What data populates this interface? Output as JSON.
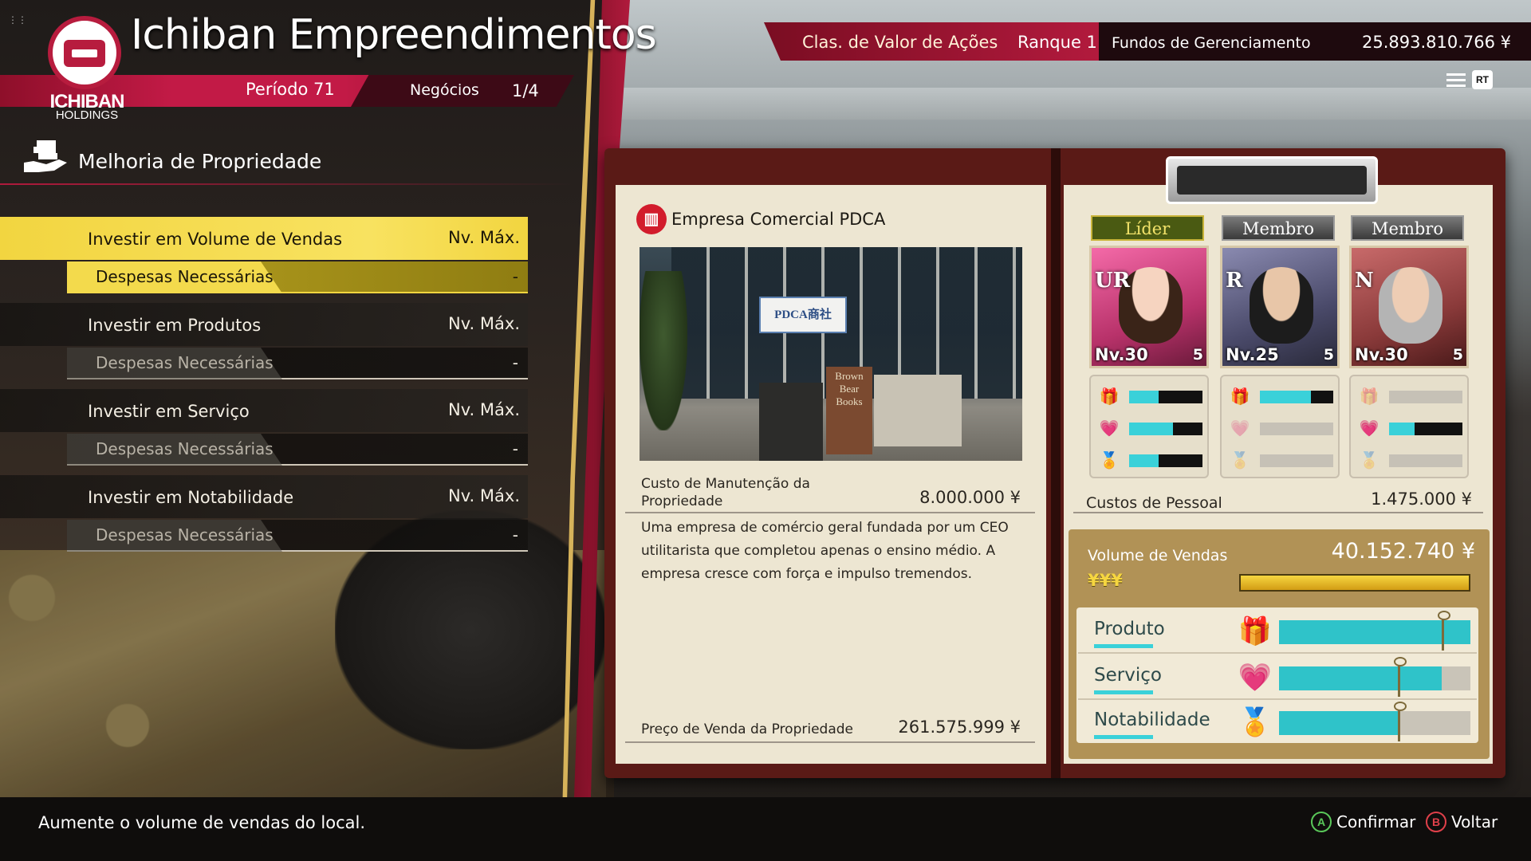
{
  "header": {
    "title": "Ichiban Empreendimentos",
    "logo_text": "ICHIBAN",
    "logo_sub": "HOLDINGS",
    "period": "Período 71",
    "deals_label": "Negócios",
    "deals_count": "1/4"
  },
  "ranking": {
    "label": "Clas. de Valor de Ações",
    "value": "Ranque 1",
    "funds_label": "Fundos de Gerenciamento",
    "funds_value": "25.893.810.766 ¥",
    "rt_button": "RT"
  },
  "section": {
    "title": "Melhoria de Propriedade"
  },
  "menu": [
    {
      "label": "Investir em Volume de Vendas",
      "level": "Nv. Máx.",
      "sub_label": "Despesas Necessárias",
      "sub_value": "-",
      "active": true
    },
    {
      "label": "Investir em Produtos",
      "level": "Nv. Máx.",
      "sub_label": "Despesas Necessárias",
      "sub_value": "-",
      "active": false
    },
    {
      "label": "Investir em Serviço",
      "level": "Nv. Máx.",
      "sub_label": "Despesas Necessárias",
      "sub_value": "-",
      "active": false
    },
    {
      "label": "Investir em Notabilidade",
      "level": "Nv. Máx.",
      "sub_label": "Despesas Necessárias",
      "sub_value": "-",
      "active": false
    }
  ],
  "property": {
    "name": "Empresa Comercial PDCA",
    "photo_sign": "PDCA商社",
    "photo_shop": "Brown Bear Books",
    "upkeep_label": "Custo de Manutenção da Propriedade",
    "upkeep_value": "8.000.000 ¥",
    "description": "Uma empresa de comércio geral fundada por um CEO utilitarista que completou apenas o ensino médio. A empresa cresce com força e impulso tremendos.",
    "sale_label": "Preço de Venda da Propriedade",
    "sale_value": "261.575.999 ¥"
  },
  "staff": [
    {
      "role": "Líder",
      "rank": "UR",
      "level": "Nv.30",
      "stars": "5",
      "stats": [
        0.4,
        0.6,
        0.4
      ]
    },
    {
      "role": "Membro",
      "rank": "R",
      "level": "Nv.25",
      "stars": "5",
      "stats": [
        0.7,
        0,
        0
      ]
    },
    {
      "role": "Membro",
      "rank": "N",
      "level": "Nv.30",
      "stars": "5",
      "stats": [
        0,
        0.35,
        0
      ]
    }
  ],
  "staff_cost_label": "Custos de Pessoal",
  "staff_cost_value": "1.475.000 ¥",
  "sales": {
    "label": "Volume de Vendas",
    "value": "40.152.740 ¥",
    "yen_marks": "¥¥¥",
    "bar_fill": 1.0
  },
  "investments": [
    {
      "label": "Produto",
      "icon": "gift-icon",
      "fill": 1.0,
      "marker": 0.85
    },
    {
      "label": "Serviço",
      "icon": "heart-hand-icon",
      "fill": 0.85,
      "marker": 0.62
    },
    {
      "label": "Notabilidade",
      "icon": "medal-icon",
      "fill": 0.62,
      "marker": 0.62
    }
  ],
  "footer": {
    "hint": "Aumente o volume de vendas do local.",
    "confirm_key": "A",
    "confirm_label": "Confirmar",
    "back_key": "B",
    "back_label": "Voltar"
  }
}
